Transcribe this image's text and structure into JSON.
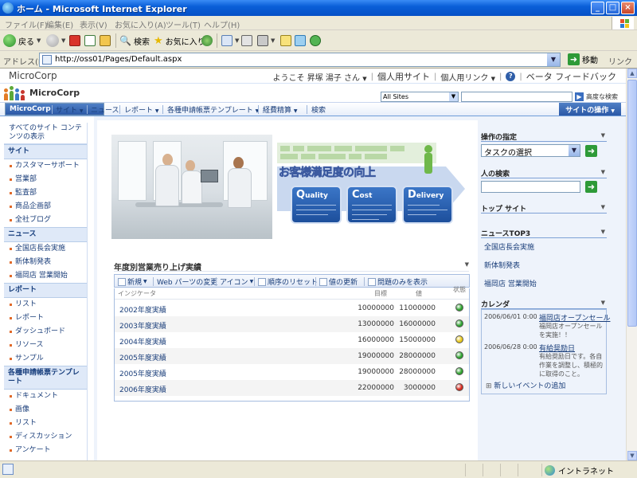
{
  "window": {
    "title": "ホーム - Microsoft Internet Explorer",
    "controls": {
      "minimize": "_",
      "maximize": "□",
      "close": "×"
    }
  },
  "menu": [
    "ファイル(F)",
    "編集(E)",
    "表示(V)",
    "お気に入り(A)",
    "ツール(T)",
    "ヘルプ(H)"
  ],
  "toolbar": {
    "back": "戻る",
    "search": "検索",
    "favorites": "お気に入り"
  },
  "address": {
    "label": "アドレス(D)",
    "url": "http://oss01/Pages/Default.aspx",
    "go": "移動",
    "links": "リンク"
  },
  "topbar": {
    "brand": "MicroCorp",
    "welcome": "ようこそ 昇塚 湯子 さん",
    "my_site": "個人用サイト",
    "my_links": "個人用リンク",
    "feedback": "ベータ フィードバック"
  },
  "header": {
    "site_title": "MicroCorp",
    "scope": "All Sites",
    "advanced_search": "高度な検索"
  },
  "nav": {
    "tabs": [
      "MicroCorp",
      "サイト",
      "ニュース",
      "レポート",
      "各種申請帳票テンプレート",
      "経費精算",
      "検索"
    ],
    "site_actions": "サイトの操作"
  },
  "leftnav": {
    "view_all": "すべてのサイト コンテンツの表示",
    "sections": [
      {
        "title": "サイト",
        "items": [
          "カスタマーサポート",
          "営業部",
          "監査部",
          "商品企画部",
          "全社ブログ"
        ]
      },
      {
        "title": "ニュース",
        "items": [
          "全国店長会実施",
          "新体制発表",
          "福岡店 営業開始"
        ]
      },
      {
        "title": "レポート",
        "items": [
          "リスト",
          "レポート",
          "ダッシュボード",
          "リソース",
          "サンプル"
        ]
      },
      {
        "title": "各種申請帳票テンプレート",
        "items": [
          "ドキュメント",
          "画像",
          "リスト",
          "ディスカッション",
          "アンケート"
        ]
      }
    ]
  },
  "banner": {
    "headline": "お客様満足度の向上",
    "boxes": [
      {
        "initial": "Q",
        "rest": "uality"
      },
      {
        "initial": "C",
        "rest": "ost"
      },
      {
        "initial": "D",
        "rest": "elivery"
      }
    ]
  },
  "kpi": {
    "title": "年度別営業売り上げ実績",
    "toolbar": [
      "新規",
      "Web パーツの変更",
      "アイコン",
      "順序のリセット",
      "値の更新",
      "問題のみを表示"
    ],
    "columns": {
      "indicator": "インジケータ",
      "goal": "目標",
      "value": "値",
      "status": "状態"
    },
    "rows": [
      {
        "name": "2002年度実績",
        "goal": "10000000",
        "value": "11000000",
        "status": "green"
      },
      {
        "name": "2003年度実績",
        "goal": "13000000",
        "value": "16000000",
        "status": "green"
      },
      {
        "name": "2004年度実績",
        "goal": "16000000",
        "value": "15000000",
        "status": "yellow"
      },
      {
        "name": "2005年度実績",
        "goal": "19000000",
        "value": "28000000",
        "status": "green"
      },
      {
        "name": "2005年度実績",
        "goal": "19000000",
        "value": "28000000",
        "status": "green"
      },
      {
        "name": "2006年度実績",
        "goal": "22000000",
        "value": "3000000",
        "status": "red"
      }
    ],
    "status_colors": {
      "green": "#2ea12e",
      "yellow": "#e8c81a",
      "red": "#d62a1e"
    }
  },
  "right": {
    "tasks_title": "操作の指定",
    "task_select": "タスクの選択",
    "people_title": "人の検索",
    "topsites_title": "トップ サイト",
    "news_title": "ニュースTOP3",
    "news": [
      "全国店長会実施",
      "新体制発表",
      "福岡店 営業開始"
    ],
    "calendar_title": "カレンダ",
    "events": [
      {
        "date": "2006/06/01 0:00",
        "title": "福岡店オープンセール",
        "desc": "福岡店オープンセールを実施！！"
      },
      {
        "date": "2006/06/28 0:00",
        "title": "有給奨励日",
        "desc": "有給奨励日です。各自作業を調整し、積極的に取得のこと。"
      }
    ],
    "add_event": "新しいイベントの追加"
  },
  "status": {
    "zone": "イントラネット"
  }
}
